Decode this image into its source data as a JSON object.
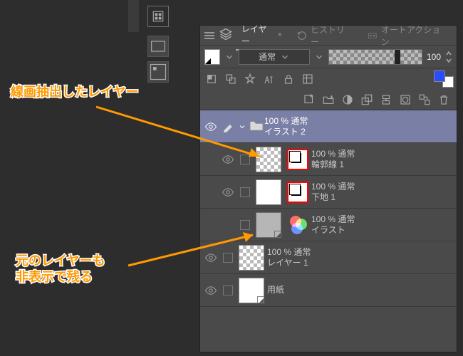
{
  "tabs": {
    "layers": "レイヤー",
    "history": "ヒストリー",
    "autoaction": "オートアクション"
  },
  "blend": {
    "mode": "通常",
    "opacity": "100"
  },
  "folder": {
    "percent": "100 % 通常",
    "name": "イラスト 2"
  },
  "layers": [
    {
      "percent": "100 % 通常",
      "name": "輪郭線 1"
    },
    {
      "percent": "100 % 通常",
      "name": "下地 1"
    },
    {
      "percent": "100 % 通常",
      "name": "イラスト"
    },
    {
      "percent": "100 % 通常",
      "name": "レイヤー 1"
    },
    {
      "percent": "",
      "name": "用紙"
    }
  ],
  "annotations": {
    "top": "線画抽出したレイヤー",
    "bottom": "元のレイヤーも\n非表示で残る"
  }
}
